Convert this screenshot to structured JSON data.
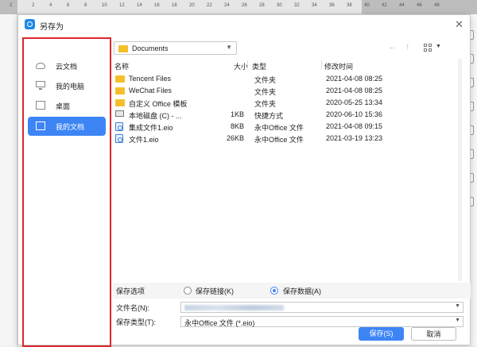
{
  "ruler": {
    "numbers": [
      "2",
      "2",
      "4",
      "6",
      "8",
      "10",
      "12",
      "14",
      "16",
      "18",
      "20",
      "22",
      "24",
      "26",
      "28",
      "30",
      "32",
      "34",
      "36",
      "38",
      "40",
      "42",
      "44",
      "46",
      "48"
    ]
  },
  "dialog": {
    "title": "另存为",
    "close_icon": "✕"
  },
  "sidebar": {
    "items": [
      {
        "label": "云文档",
        "icon": "cloud-icon"
      },
      {
        "label": "我的电脑",
        "icon": "computer-icon"
      },
      {
        "label": "桌面",
        "icon": "desktop-icon"
      },
      {
        "label": "我的文档",
        "icon": "documents-icon",
        "active": true
      }
    ]
  },
  "toolbar": {
    "path": "Documents",
    "back_icon": "←",
    "up_icon": "↑",
    "view_drop": "▼"
  },
  "columns": {
    "name": "名称",
    "size": "大小",
    "type": "类型",
    "modified": "修改时间"
  },
  "files": [
    {
      "name": "Tencent Files",
      "size": "",
      "type": "文件夹",
      "modified": "2021-04-08 08:25",
      "icon": "folder-icon"
    },
    {
      "name": "WeChat Files",
      "size": "",
      "type": "文件夹",
      "modified": "2021-04-08 08:25",
      "icon": "folder-icon"
    },
    {
      "name": "自定义 Office 模板",
      "size": "",
      "type": "文件夹",
      "modified": "2020-05-25 13:34",
      "icon": "folder-icon"
    },
    {
      "name": "本地磁盘 (C) - ...",
      "size": "1KB",
      "type": "快捷方式",
      "modified": "2020-06-10 15:36",
      "icon": "drive-shortcut-icon"
    },
    {
      "name": "集成文件1.eio",
      "size": "8KB",
      "type": "永中Office 文件",
      "modified": "2021-04-08 09:15",
      "icon": "eio-file-icon"
    },
    {
      "name": "文件1.eio",
      "size": "26KB",
      "type": "永中Office 文件",
      "modified": "2021-03-19 13:23",
      "icon": "eio-file-icon"
    }
  ],
  "save_options": {
    "label": "保存选项",
    "options": [
      {
        "label": "保存链接(K)",
        "selected": false
      },
      {
        "label": "保存数据(A)",
        "selected": true
      }
    ]
  },
  "form": {
    "filename_label": "文件名(N):",
    "filetype_label": "保存类型(T):",
    "filetype_value": "永中Office 文件 (*.eio)",
    "drop": "▼"
  },
  "buttons": {
    "save": "保存(S)",
    "cancel": "取消"
  },
  "colors": {
    "accent": "#3d85f5",
    "highlight_border": "#e0262d",
    "folder": "#f5bf2b"
  }
}
